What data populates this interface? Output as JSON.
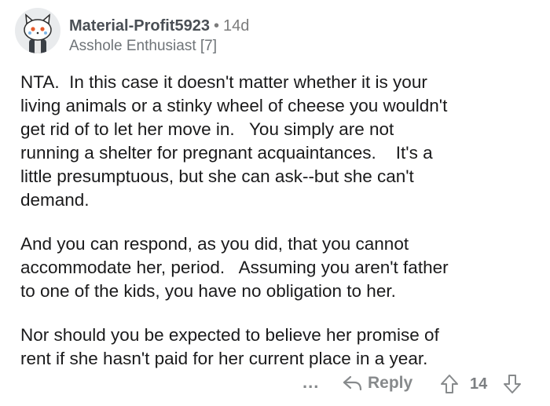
{
  "comment": {
    "author": "Material-Profit5923",
    "separator": "•",
    "age": "14d",
    "flair": "Asshole Enthusiast [7]",
    "paragraphs": [
      "NTA.  In this case it doesn't matter whether it is your\nliving animals or a stinky wheel of cheese you wouldn't\nget rid of to let her move in.   You simply are not\nrunning a shelter for pregnant acquaintances.    It's a\nlittle presumptuous, but she can ask--but she can't\ndemand.",
      "And you can respond, as you did, that you cannot\naccommodate her, period.   Assuming you aren't father\nto one of the kids, you have no obligation to her.",
      "Nor should you be expected to believe her promise of\nrent if she hasn't paid for her current place in a year."
    ]
  },
  "actions": {
    "more": "...",
    "reply_label": "Reply",
    "score": "14",
    "icons": {
      "reply": "reply-arrow-icon",
      "upvote": "upvote-arrow-icon",
      "downvote": "downvote-arrow-icon"
    }
  },
  "colors": {
    "text": "#1a1a1b",
    "muted": "#878a8c",
    "username": "#4a4f55"
  }
}
